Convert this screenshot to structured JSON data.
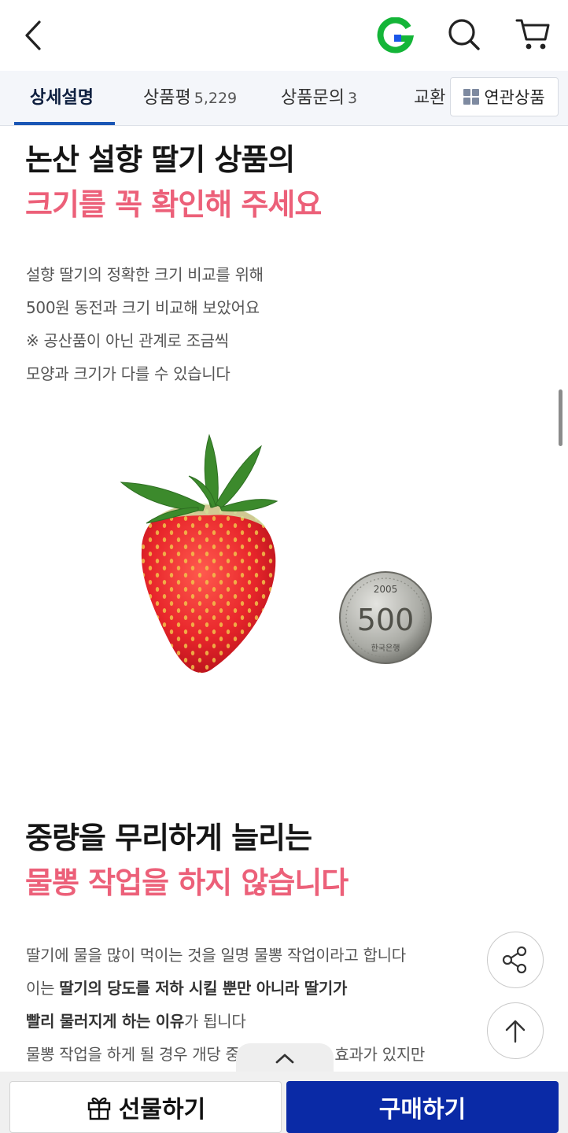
{
  "header": {
    "back_icon": "chevron-left-icon",
    "logo_text": "G",
    "search_icon": "search-icon",
    "cart_icon": "cart-icon",
    "colors": {
      "logo_green": "#14b538",
      "logo_blue": "#1a56e8"
    }
  },
  "tabs": {
    "items": [
      {
        "label": "상세설명",
        "count": ""
      },
      {
        "label": "상품평",
        "count": "5,229"
      },
      {
        "label": "상품문의",
        "count": "3"
      },
      {
        "label": "교환",
        "count": ""
      }
    ],
    "related_label": "연관상품",
    "accent": "#1a56b5"
  },
  "section1": {
    "heading_line1": "논산 설향 딸기 상품의",
    "heading_line2": "크기를 꼭 확인해 주세요",
    "lines": [
      "설향 딸기의 정확한 크기 비교를 위해",
      "500원 동전과 크기 비교해 보았어요",
      "※ 공산품이 아닌 관계로 조금씩",
      "모양과 크기가 다를 수 있습니다"
    ]
  },
  "image": {
    "coin_year": "2005",
    "coin_value": "500",
    "coin_country": "한국은행"
  },
  "section2": {
    "heading_line1": "중량을 무리하게 늘리는",
    "heading_line2": "물뽕 작업을 하지 않습니다",
    "line1": "딸기에 물을 많이 먹이는 것을 일명 물뽕 작업이라고 합니다",
    "line2_prefix": "이는 ",
    "line2_bold": "딸기의 당도를 저하 시킬 뿐만 아니라 딸기가",
    "line3_bold": "빨리 물러지게 하는 이유",
    "line3_suffix": "가 됩니다",
    "line4": "물뽕 작업을 하게 될 경우 개당 중량이 늘어나는 효과가 있지만"
  },
  "floating": {
    "share_icon": "share-icon",
    "top_icon": "arrow-up-icon",
    "collapse_icon": "chevron-up-icon"
  },
  "bottom": {
    "gift_label": "선물하기",
    "gift_icon": "gift-icon",
    "buy_label": "구매하기",
    "buy_color": "#0a2aa6"
  }
}
